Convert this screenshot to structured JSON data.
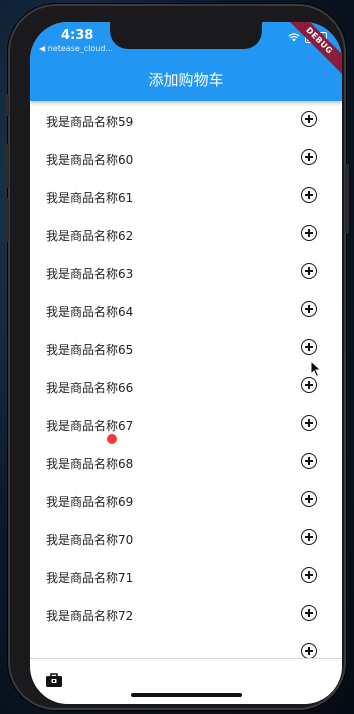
{
  "status_bar": {
    "time": "4:38",
    "back_app": "◀ netease_cloud...",
    "debug_banner": "DEBUG"
  },
  "app_bar": {
    "title": "添加购物车",
    "color": "#2196F3"
  },
  "list": {
    "items": [
      {
        "label": "我是商品名称59"
      },
      {
        "label": "我是商品名称60"
      },
      {
        "label": "我是商品名称61"
      },
      {
        "label": "我是商品名称62"
      },
      {
        "label": "我是商品名称63"
      },
      {
        "label": "我是商品名称64"
      },
      {
        "label": "我是商品名称65"
      },
      {
        "label": "我是商品名称66"
      },
      {
        "label": "我是商品名称67"
      },
      {
        "label": "我是商品名称68"
      },
      {
        "label": "我是商品名称69"
      },
      {
        "label": "我是商品名称70"
      },
      {
        "label": "我是商品名称71"
      },
      {
        "label": "我是商品名称72"
      }
    ],
    "add_icon": "add-circle-outline-icon"
  },
  "bottom_bar": {
    "icon": "shopping-bag-icon"
  }
}
